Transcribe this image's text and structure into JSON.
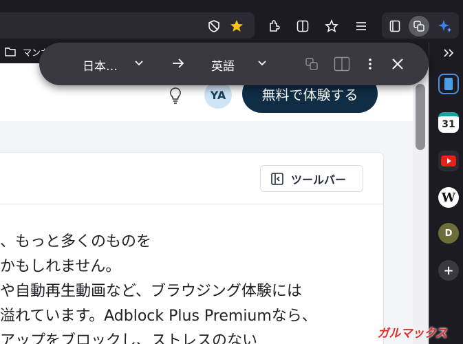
{
  "bookmarks": {
    "folder_label": "マンガ"
  },
  "translate_bar": {
    "source_language": "日本…",
    "target_language": "英語"
  },
  "header": {
    "avatar_initials": "YA",
    "cta_label": "無料で体験する"
  },
  "card": {
    "toolbar_button_label": "ツールバー",
    "lines": [
      "、もっと多くのものを",
      "かもしれません。",
      "や自動再生動画など、ブラウジング体験には",
      "溢れています。Adblock Plus Premiumなら、",
      "アップをブロックし、ストレスのない"
    ]
  },
  "sidebar": {
    "profile_initial": "D",
    "calendar_day": "31"
  },
  "watermark": {
    "label": "ガルマックス"
  }
}
